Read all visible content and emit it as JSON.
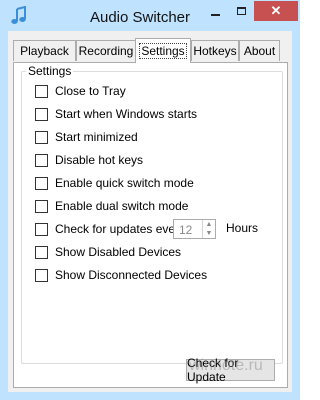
{
  "window": {
    "title": "Audio Switcher",
    "icon": "music-note-icon",
    "accent": "#bfe3ff",
    "close_color": "#c75050"
  },
  "tabs": [
    {
      "label": "Playback",
      "active": false
    },
    {
      "label": "Recording",
      "active": false
    },
    {
      "label": "Settings",
      "active": true
    },
    {
      "label": "Hotkeys",
      "active": false
    },
    {
      "label": "About",
      "active": false
    }
  ],
  "settings": {
    "group_label": "Settings",
    "options": [
      {
        "label": "Close to Tray",
        "checked": false
      },
      {
        "label": "Start when Windows starts",
        "checked": false
      },
      {
        "label": "Start minimized",
        "checked": false
      },
      {
        "label": "Disable hot keys",
        "checked": false
      },
      {
        "label": "Enable quick switch mode",
        "checked": false
      },
      {
        "label": "Enable dual switch mode",
        "checked": false
      },
      {
        "label": "Check for updates every",
        "checked": false
      },
      {
        "label": "Show Disabled Devices",
        "checked": false
      },
      {
        "label": "Show Disconnected Devices",
        "checked": false
      }
    ],
    "update_interval": {
      "value": "12",
      "unit": "Hours",
      "enabled": false
    }
  },
  "buttons": {
    "check_update": "Check for Update"
  },
  "watermark": "winnote.ru"
}
